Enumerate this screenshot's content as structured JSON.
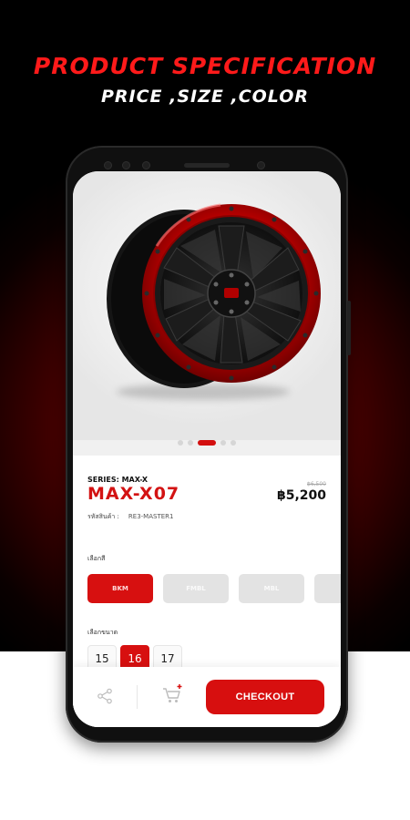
{
  "hero": {
    "title": "PRODUCT SPECIFICATION",
    "subtitle": "PRICE ,SIZE ,COLOR"
  },
  "gallery": {
    "slide_count": 5,
    "active_slide": 3
  },
  "product": {
    "series": "SERIES: MAX-X",
    "model": "MAX-X07",
    "old_price": "฿6,500",
    "price": "฿5,200",
    "sku_label": "รหัสสินค้า :",
    "sku_value": "RE3-MASTER1"
  },
  "color": {
    "label": "เลือกสี",
    "options": [
      "BKM",
      "FMBL",
      "MBL",
      ""
    ],
    "selected": "BKM"
  },
  "size": {
    "label": "เลือกขนาด",
    "options": [
      "15",
      "16",
      "17"
    ],
    "selected": "16"
  },
  "bottom_bar": {
    "checkout_label": "CHECKOUT"
  },
  "colors": {
    "accent": "#d71010",
    "title_red": "#ff1a1a",
    "background_dark": "#000000"
  }
}
